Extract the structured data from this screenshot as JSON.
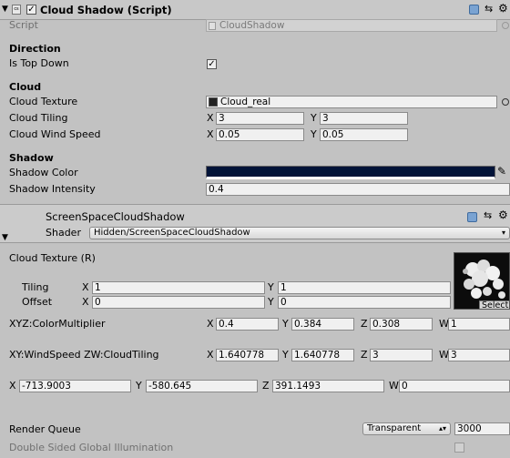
{
  "component1": {
    "title": "Cloud Shadow (Script)",
    "script_label": "Script",
    "script_value": "CloudShadow",
    "direction_header": "Direction",
    "is_top_down_label": "Is Top Down",
    "is_top_down_checked": true,
    "cloud_header": "Cloud",
    "cloud_texture_label": "Cloud Texture",
    "cloud_texture_value": "Cloud_real",
    "cloud_tiling_label": "Cloud Tiling",
    "cloud_tiling_x": "3",
    "cloud_tiling_y": "3",
    "cloud_wind_speed_label": "Cloud Wind Speed",
    "wind_x": "0.05",
    "wind_y": "0.05",
    "shadow_header": "Shadow",
    "shadow_color_label": "Shadow Color",
    "shadow_color": "#011338",
    "shadow_intensity_label": "Shadow Intensity",
    "shadow_intensity_value": "0.4"
  },
  "material": {
    "name": "ScreenSpaceCloudShadow",
    "shader_label": "Shader",
    "shader_value": "Hidden/ScreenSpaceCloudShadow",
    "cloud_texture_label": "Cloud Texture (R)",
    "select_label": "Select",
    "tiling_label": "Tiling",
    "tiling_x": "1",
    "tiling_y": "1",
    "offset_label": "Offset",
    "offset_x": "0",
    "offset_y": "0",
    "color_multiplier_label": "XYZ:ColorMultiplier",
    "cm_x": "0.4",
    "cm_y": "0.384",
    "cm_z": "0.308",
    "cm_w": "1",
    "wind_tiling_label": "XY:WindSpeed ZW:CloudTiling",
    "wt_x": "1.640778",
    "wt_y": "1.640778",
    "wt_z": "3",
    "wt_w": "3",
    "vec_x": "-713.9003",
    "vec_y": "-580.645",
    "vec_z": "391.1493",
    "vec_w": "0",
    "render_queue_label": "Render Queue",
    "render_queue_mode": "Transparent",
    "render_queue_value": "3000",
    "double_sided_label": "Double Sided Global Illumination"
  },
  "axes": {
    "x": "X",
    "y": "Y",
    "z": "Z",
    "w": "W"
  }
}
